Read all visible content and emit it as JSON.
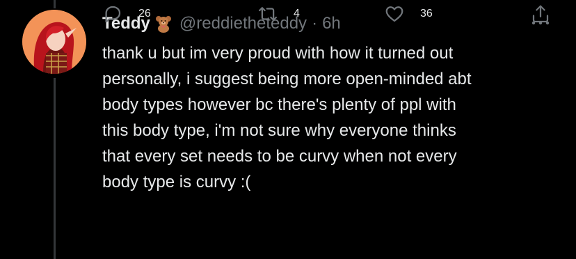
{
  "tweet": {
    "author": {
      "display_name": "Teddy",
      "name_emoji": "teddy-bear-emoji",
      "handle": "@reddietheteddy"
    },
    "separator": "·",
    "time": "6h",
    "text": "thank u but im very proud with how it turned out\npersonally, i suggest being more open-minded abt\nbody types however bc there's plenty of ppl with\nthis body type, i'm not sure why everyone thinks\nthat every set needs to be curvy when not every\nbody type is curvy :(",
    "actions": {
      "reply_count": "26",
      "retweet_count": "4",
      "like_count": "36"
    }
  },
  "icons": {
    "more": "more-horizontal-icon",
    "reply": "reply-icon",
    "retweet": "retweet-icon",
    "like": "heart-icon",
    "share": "share-icon"
  },
  "colors": {
    "background": "#000000",
    "primary_text": "#e7e9ea",
    "secondary_text": "#71767b",
    "thread_line": "#333639"
  }
}
